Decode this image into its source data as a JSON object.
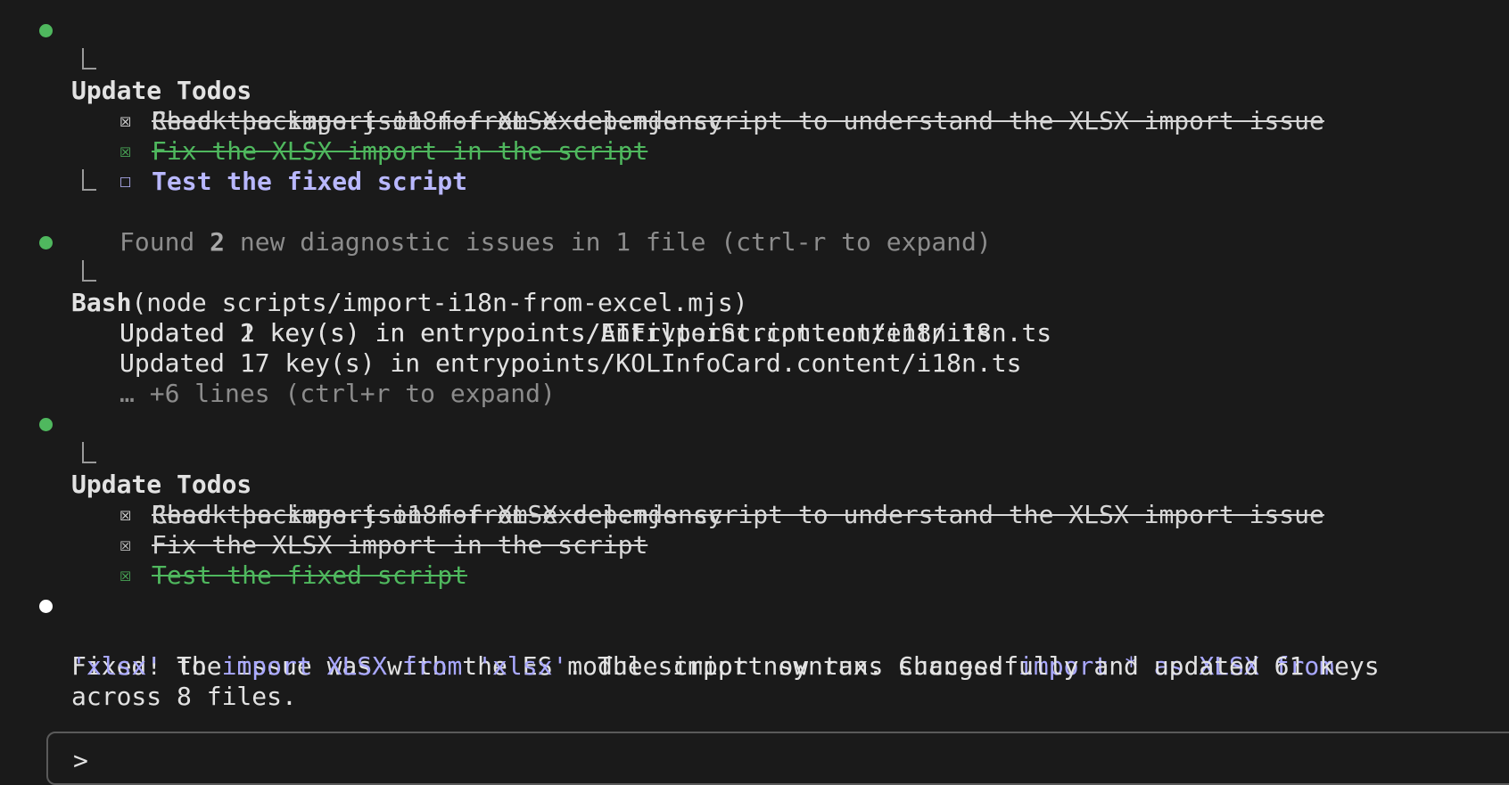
{
  "block1": {
    "title": "Update Todos",
    "todos": [
      {
        "text": "Read the import-i18n-from-excel.mjs script to understand the XLSX import issue",
        "box": "☒"
      },
      {
        "text": "Check package.json for XLSX dependency",
        "box": "☒"
      },
      {
        "text": "Fix the XLSX import in the script",
        "box": "☒"
      },
      {
        "text": "Test the fixed script",
        "box": "☐"
      }
    ],
    "diag_prefix": "Found ",
    "diag_count": "2",
    "diag_suffix": " new diagnostic issues in 1 file (ctrl-r to expand)"
  },
  "block2": {
    "tool": "Bash",
    "command": "(node scripts/import-i18n-from-excel.mjs)",
    "output": [
      "Updated 2 key(s) in entrypoints/AIFilterScript.content/i18n.ts",
      "Updated 1 key(s) in entrypoints/Entrypoint.content/i18n.ts",
      "Updated 17 key(s) in entrypoints/KOLInfoCard.content/i18n.ts"
    ],
    "more": "… +6 lines (ctrl+r to expand)"
  },
  "block3": {
    "title": "Update Todos",
    "todos": [
      {
        "text": "Read the import-i18n-from-excel.mjs script to understand the XLSX import issue",
        "box": "☒"
      },
      {
        "text": "Check package.json for XLSX dependency",
        "box": "☒"
      },
      {
        "text": "Fix the XLSX import in the script",
        "box": "☒"
      },
      {
        "text": "Test the fixed script",
        "box": "☒"
      }
    ]
  },
  "message": {
    "p1": "Fixed! The issue was with the ES module import syntax. Changed ",
    "code1": "import * as XLSX from",
    "p2": "'xlsx'",
    "p3": " to ",
    "code2": "import XLSX from 'xlsx'",
    "p4": ". The script now runs successfully and updated 61 keys",
    "p5": "across 8 files."
  },
  "input": {
    "prompt": ">"
  },
  "colors": {
    "background": "#1a1a1a",
    "bullet_green": "#4fb85e",
    "active_todo": "#b9b8ff",
    "code_highlight": "#a9a8ff",
    "dim_text": "#8c8c8c"
  }
}
